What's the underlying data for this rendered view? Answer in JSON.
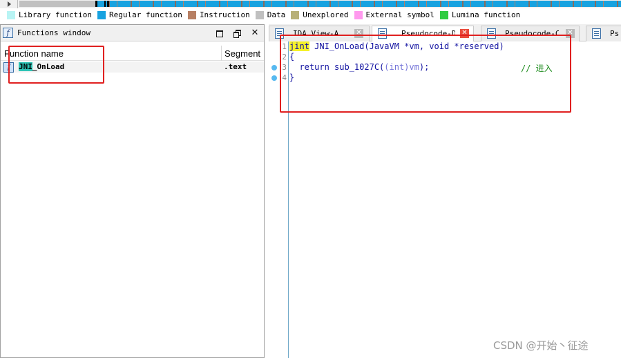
{
  "legend": [
    {
      "label": "Library function",
      "color": "#b8f4f4"
    },
    {
      "label": "Regular function",
      "color": "#17a2e0"
    },
    {
      "label": "Instruction",
      "color": "#b77f63"
    },
    {
      "label": "Data",
      "color": "#c0c0c0"
    },
    {
      "label": "Unexplored",
      "color": "#b8b077"
    },
    {
      "label": "External symbol",
      "color": "#ff99ee"
    },
    {
      "label": "Lumina function",
      "color": "#2ecc40"
    }
  ],
  "functions_window": {
    "title": "Functions window",
    "icon": "function-f-icon",
    "columns": {
      "name": "Function name",
      "segment": "Segment"
    },
    "rows": [
      {
        "name": "JNI_OnLoad",
        "segment": ".text",
        "icon": "function-icon"
      }
    ],
    "buttons": {
      "maximize": "",
      "float": "",
      "close": "✕"
    }
  },
  "tabs": [
    {
      "label": "IDA View-A",
      "active": false
    },
    {
      "label": "Pseudocode-D",
      "active": true
    },
    {
      "label": "Pseudocode-C",
      "active": false
    },
    {
      "label": "Ps",
      "active": false
    }
  ],
  "pseudocode": {
    "line_numbers": [
      "1",
      "2",
      "3",
      "4"
    ],
    "lines": [
      {
        "type": "jint",
        "text": " JNI_OnLoad(JavaVM *vm, void *reserved)"
      },
      {
        "text": "{"
      },
      {
        "pre": "  return sub_1027C(",
        "cast": "(int)vm",
        "post": ");",
        "comment": "// 进入"
      },
      {
        "text": "}"
      }
    ]
  },
  "watermark": "CSDN @开始丶征途"
}
